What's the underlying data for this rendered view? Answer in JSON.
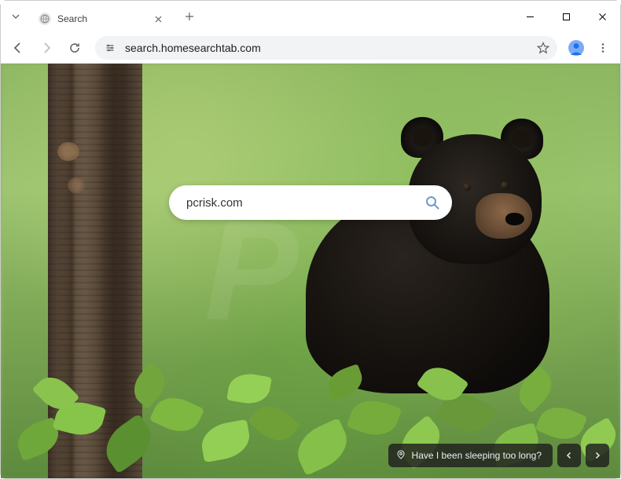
{
  "window": {
    "tab_title": "Search",
    "minimize_tip": "Minimize",
    "maximize_tip": "Maximize",
    "close_tip": "Close"
  },
  "toolbar": {
    "url": "search.homesearchtab.com",
    "back_tip": "Back",
    "forward_tip": "Forward",
    "reload_tip": "Reload",
    "bookmark_tip": "Bookmark this page",
    "profile_tip": "Profile",
    "menu_tip": "Menu"
  },
  "page": {
    "search_value": "pcrisk.com",
    "search_placeholder": "Search"
  },
  "bottom_widget": {
    "caption": "Have I been sleeping too long?",
    "prev_tip": "Previous",
    "next_tip": "Next"
  }
}
